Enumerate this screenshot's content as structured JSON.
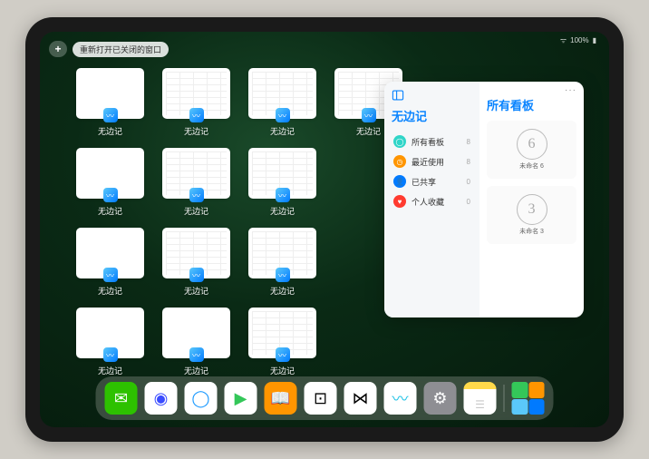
{
  "status": {
    "battery": "100%"
  },
  "controls": {
    "plus": "+",
    "reopen_label": "重新打开已关闭的窗口"
  },
  "app_name": "无边记",
  "windows": [
    {
      "detailed": false
    },
    {
      "detailed": true
    },
    {
      "detailed": true
    },
    {
      "detailed": true
    },
    {
      "detailed": false
    },
    {
      "detailed": true
    },
    {
      "detailed": true
    },
    {
      "detailed": false
    },
    {
      "detailed": true
    },
    {
      "detailed": true
    },
    {
      "detailed": false
    },
    {
      "detailed": false
    },
    {
      "detailed": true
    }
  ],
  "popup": {
    "title": "无边记",
    "right_title": "所有看板",
    "sidebar": [
      {
        "label": "所有看板",
        "count": "8",
        "color": "teal",
        "glyph": "◯"
      },
      {
        "label": "最近使用",
        "count": "8",
        "color": "orange",
        "glyph": "◷"
      },
      {
        "label": "已共享",
        "count": "0",
        "color": "blue",
        "glyph": "👤"
      },
      {
        "label": "个人收藏",
        "count": "0",
        "color": "red",
        "glyph": "♥"
      }
    ],
    "boards": [
      {
        "sketch": "6",
        "name": "未命名 6",
        "sub": ""
      },
      {
        "sketch": "3",
        "name": "未命名 3",
        "sub": ""
      }
    ]
  },
  "dock": {
    "icons": [
      {
        "name": "wechat-icon",
        "bg": "#2dc100",
        "glyph": "✉"
      },
      {
        "name": "quark-icon",
        "bg": "#ffffff",
        "glyph": "◉",
        "fg": "#3a4cff"
      },
      {
        "name": "qqbrowser-icon",
        "bg": "#ffffff",
        "glyph": "◯",
        "fg": "#1e9bff"
      },
      {
        "name": "play-icon",
        "bg": "#ffffff",
        "glyph": "▶",
        "fg": "#34c759"
      },
      {
        "name": "books-icon",
        "bg": "#ff9500",
        "glyph": "📖"
      },
      {
        "name": "dice-icon",
        "bg": "#ffffff",
        "glyph": "⊡",
        "fg": "#000"
      },
      {
        "name": "connect-icon",
        "bg": "#ffffff",
        "glyph": "⋈",
        "fg": "#000"
      },
      {
        "name": "freeform-icon",
        "bg": "#ffffff",
        "glyph": "〰",
        "fg": "#22c3e6"
      },
      {
        "name": "settings-icon",
        "bg": "#8e8e93",
        "glyph": "⚙"
      },
      {
        "name": "notes-icon",
        "bg": "#ffffff",
        "glyph": "☰",
        "fg": "#d0a030",
        "top": true
      }
    ]
  }
}
